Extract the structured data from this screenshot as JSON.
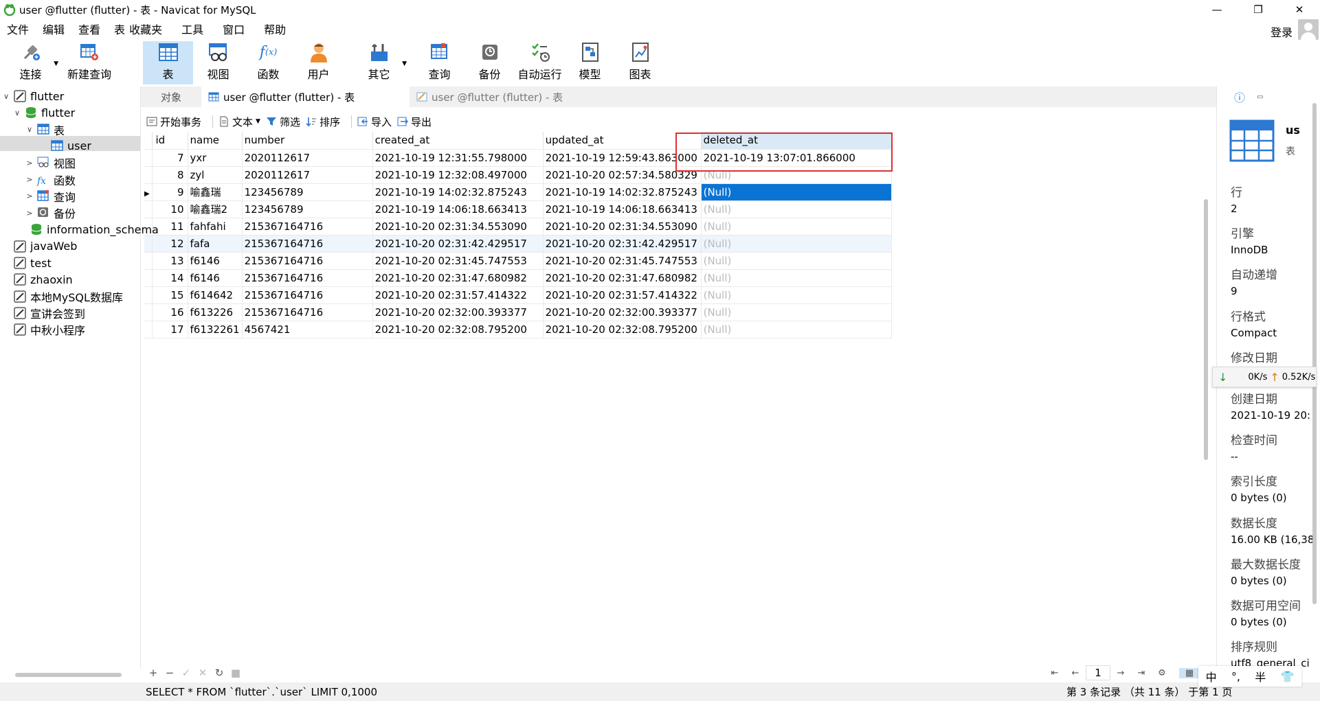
{
  "window": {
    "title": "user @flutter (flutter) - 表 - Navicat for MySQL",
    "controls": [
      "—",
      "❐",
      "✕"
    ]
  },
  "menu": [
    "文件",
    "编辑",
    "查看",
    "表",
    "收藏夹",
    "工具",
    "窗口",
    "帮助"
  ],
  "login": "登录",
  "toolbar": {
    "connect": "连接",
    "new_query": "新建查询",
    "table": "表",
    "view": "视图",
    "function": "函数",
    "user": "用户",
    "other": "其它",
    "query": "查询",
    "backup": "备份",
    "auto_run": "自动运行",
    "model": "模型",
    "chart": "图表"
  },
  "tree": [
    {
      "label": "flutter",
      "arrow": "∨",
      "icon": "connection-icon"
    },
    {
      "label": "flutter",
      "arrow": "∨",
      "icon": "database-icon"
    },
    {
      "label": "表",
      "arrow": "∨",
      "icon": "table-folder-icon"
    },
    {
      "label": "user",
      "arrow": "",
      "icon": "table-icon"
    },
    {
      "label": "视图",
      "arrow": ">",
      "icon": "view-icon"
    },
    {
      "label": "函数",
      "arrow": ">",
      "icon": "function-icon"
    },
    {
      "label": "查询",
      "arrow": ">",
      "icon": "query-icon"
    },
    {
      "label": "备份",
      "arrow": ">",
      "icon": "backup-icon"
    },
    {
      "label": "information_schema",
      "arrow": "",
      "icon": "database-icon"
    },
    {
      "label": "javaWeb",
      "arrow": "",
      "icon": "connection-icon"
    },
    {
      "label": "test",
      "arrow": "",
      "icon": "connection-icon"
    },
    {
      "label": "zhaoxin",
      "arrow": "",
      "icon": "connection-icon"
    },
    {
      "label": "本地MySQL数据库",
      "arrow": "",
      "icon": "connection-icon"
    },
    {
      "label": "宣讲会签到",
      "arrow": "",
      "icon": "connection-icon"
    },
    {
      "label": "中秋小程序",
      "arrow": "",
      "icon": "connection-icon"
    }
  ],
  "tabs": {
    "objects": "对象",
    "active": "user @flutter (flutter) - 表",
    "inactive": "user @flutter (flutter) - 表"
  },
  "table_toolbar": {
    "begin_tx": "开始事务",
    "text": "文本",
    "filter": "筛选",
    "sort": "排序",
    "import": "导入",
    "export": "导出"
  },
  "grid": {
    "columns": [
      "id",
      "name",
      "number",
      "created_at",
      "updated_at",
      "deleted_at"
    ],
    "rows": [
      [
        "7",
        "yxr",
        "2020112617",
        "2021-10-19 12:31:55.798000",
        "2021-10-19 12:59:43.863000",
        "2021-10-19 13:07:01.866000"
      ],
      [
        "8",
        "zyl",
        "2020112617",
        "2021-10-19 12:32:08.497000",
        "2021-10-20 02:57:34.580329",
        "(Null)"
      ],
      [
        "9",
        "喻鑫瑞",
        "123456789",
        "2021-10-19 14:02:32.875243",
        "2021-10-19 14:02:32.875243",
        "(Null)"
      ],
      [
        "10",
        "喻鑫瑞2",
        "123456789",
        "2021-10-19 14:06:18.663413",
        "2021-10-19 14:06:18.663413",
        "(Null)"
      ],
      [
        "11",
        "fahfahi",
        "215367164716",
        "2021-10-20 02:31:34.553090",
        "2021-10-20 02:31:34.553090",
        "(Null)"
      ],
      [
        "12",
        "fafa",
        "215367164716",
        "2021-10-20 02:31:42.429517",
        "2021-10-20 02:31:42.429517",
        "(Null)"
      ],
      [
        "13",
        "f6146",
        "215367164716",
        "2021-10-20 02:31:45.747553",
        "2021-10-20 02:31:45.747553",
        "(Null)"
      ],
      [
        "14",
        "f6146",
        "215367164716",
        "2021-10-20 02:31:47.680982",
        "2021-10-20 02:31:47.680982",
        "(Null)"
      ],
      [
        "15",
        "f614642",
        "215367164716",
        "2021-10-20 02:31:57.414322",
        "2021-10-20 02:31:57.414322",
        "(Null)"
      ],
      [
        "16",
        "f613226",
        "215367164716",
        "2021-10-20 02:32:00.393377",
        "2021-10-20 02:32:00.393377",
        "(Null)"
      ],
      [
        "17",
        "f6132261",
        "4567421",
        "2021-10-20 02:32:08.795200",
        "2021-10-20 02:32:08.795200",
        "(Null)"
      ]
    ],
    "current_row_index": 2,
    "hover_row_index": 5
  },
  "footer": {
    "buttons": [
      "+",
      "−",
      "✓",
      "✕",
      "↻",
      "■"
    ],
    "page": "1",
    "sql": "SELECT * FROM `flutter`.`user` LIMIT 0,1000",
    "record_info": "第 3 条记录 （共 11 条） 于第 1 页"
  },
  "right_panel": {
    "name": "us",
    "type": "表",
    "fields": [
      {
        "label": "行",
        "value": "2"
      },
      {
        "label": "引擎",
        "value": "InnoDB"
      },
      {
        "label": "自动递增",
        "value": "9"
      },
      {
        "label": "行格式",
        "value": "Compact"
      },
      {
        "label": "修改日期",
        "value": ""
      },
      {
        "label": "创建日期",
        "value": "2021-10-19 20:"
      },
      {
        "label": "检查时间",
        "value": "--"
      },
      {
        "label": "索引长度",
        "value": "0 bytes (0)"
      },
      {
        "label": "数据长度",
        "value": "16.00 KB (16,38"
      },
      {
        "label": "最大数据长度",
        "value": "0 bytes (0)"
      },
      {
        "label": "数据可用空间",
        "value": "0 bytes (0)"
      },
      {
        "label": "排序规则",
        "value": "utf8_general_ci"
      }
    ]
  },
  "net_monitor": {
    "down": "0K/s",
    "up": "0.52K/s"
  },
  "ime": [
    "中",
    "°,",
    "半",
    "👕"
  ],
  "colors": {
    "selection": "#0a74d4",
    "highlight_box": "#e03030",
    "active_tool": "#cce4f7"
  }
}
